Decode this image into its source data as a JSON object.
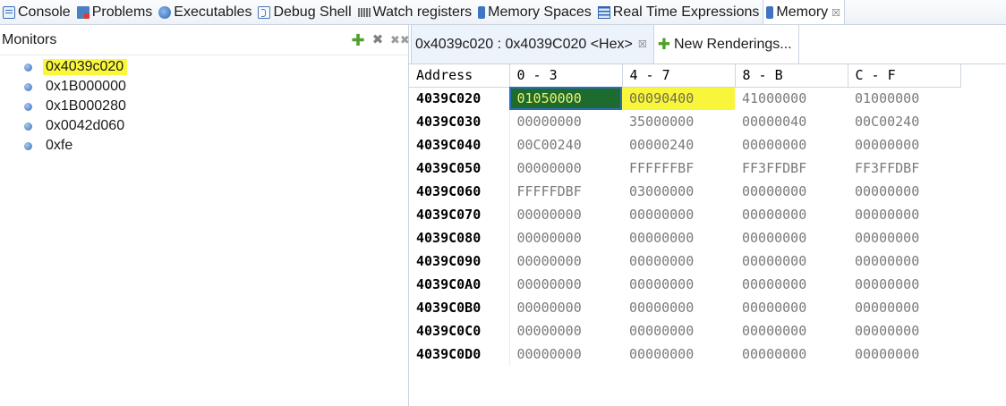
{
  "tabs": [
    {
      "id": "console",
      "label": "Console",
      "icon": "console-icon",
      "active": false
    },
    {
      "id": "problems",
      "label": "Problems",
      "icon": "problems-icon",
      "active": false
    },
    {
      "id": "executables",
      "label": "Executables",
      "icon": "executables-icon",
      "active": false
    },
    {
      "id": "debug-shell",
      "label": "Debug Shell",
      "icon": "debug-shell-icon",
      "active": false
    },
    {
      "id": "watch-registers",
      "label": "Watch registers",
      "icon": "watch-registers-icon",
      "active": false
    },
    {
      "id": "memory-spaces",
      "label": "Memory Spaces",
      "icon": "memory-spaces-icon",
      "active": false
    },
    {
      "id": "real-time-expressions",
      "label": "Real Time Expressions",
      "icon": "real-time-expressions-icon",
      "active": false
    },
    {
      "id": "memory",
      "label": "Memory",
      "icon": "memory-icon",
      "active": true,
      "close": "☒"
    }
  ],
  "monitors": {
    "title": "Monitors",
    "items": [
      "0x4039c020",
      "0x1B000000",
      "0x1B000280",
      "0x0042d060",
      "0xfe"
    ],
    "selected_index": 0
  },
  "rendering": {
    "tab_label": "0x4039c020 : 0x4039C020 <Hex>",
    "tab_close": "☒",
    "new_renderings_label": "New Renderings...",
    "columns": [
      "Address",
      "0 - 3",
      "4 - 7",
      "8 - B",
      "C - F"
    ],
    "rows": [
      {
        "addr": "4039C020",
        "cells": [
          "01050000",
          "00090400",
          "41000000",
          "01000000"
        ]
      },
      {
        "addr": "4039C030",
        "cells": [
          "00000000",
          "35000000",
          "00000040",
          "00C00240"
        ]
      },
      {
        "addr": "4039C040",
        "cells": [
          "00C00240",
          "00000240",
          "00000000",
          "00000000"
        ]
      },
      {
        "addr": "4039C050",
        "cells": [
          "00000000",
          "FFFFFFBF",
          "FF3FFDBF",
          "FF3FFDBF"
        ]
      },
      {
        "addr": "4039C060",
        "cells": [
          "FFFFFDBF",
          "03000000",
          "00000000",
          "00000000"
        ]
      },
      {
        "addr": "4039C070",
        "cells": [
          "00000000",
          "00000000",
          "00000000",
          "00000000"
        ]
      },
      {
        "addr": "4039C080",
        "cells": [
          "00000000",
          "00000000",
          "00000000",
          "00000000"
        ]
      },
      {
        "addr": "4039C090",
        "cells": [
          "00000000",
          "00000000",
          "00000000",
          "00000000"
        ]
      },
      {
        "addr": "4039C0A0",
        "cells": [
          "00000000",
          "00000000",
          "00000000",
          "00000000"
        ]
      },
      {
        "addr": "4039C0B0",
        "cells": [
          "00000000",
          "00000000",
          "00000000",
          "00000000"
        ]
      },
      {
        "addr": "4039C0C0",
        "cells": [
          "00000000",
          "00000000",
          "00000000",
          "00000000"
        ]
      },
      {
        "addr": "4039C0D0",
        "cells": [
          "00000000",
          "00000000",
          "00000000",
          "00000000"
        ]
      }
    ],
    "selected_cell": {
      "row": 0,
      "col": 0
    },
    "highlighted_cell": {
      "row": 0,
      "col": 1
    }
  },
  "colors": {
    "selected_cell_bg": "#1d6b2e",
    "selected_cell_text": "#f6f16a",
    "highlight_yellow": "#f8f53a",
    "accent_blue": "#2a6fbb",
    "add_green": "#4ea12a"
  }
}
